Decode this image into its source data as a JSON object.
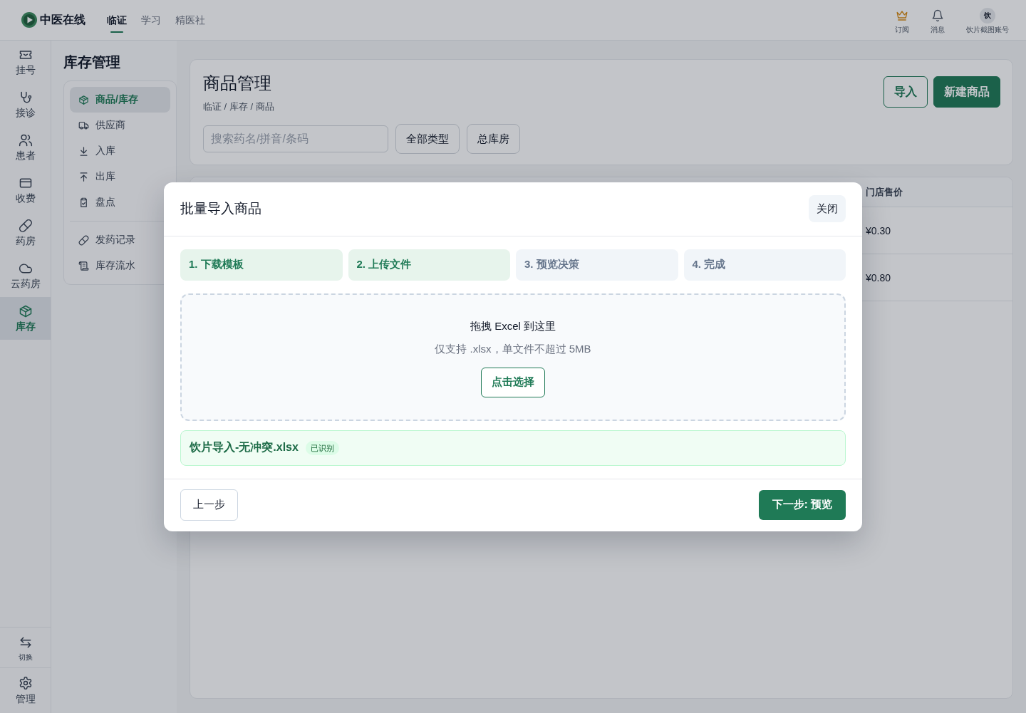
{
  "top_bar": {
    "brand": "中医在线",
    "nav": [
      {
        "label": "临证",
        "selected": true
      },
      {
        "label": "学习",
        "selected": false
      },
      {
        "label": "精医社",
        "selected": false
      }
    ],
    "actions": [
      {
        "label": "订阅"
      },
      {
        "label": "消息"
      }
    ],
    "account": {
      "avatar_text": "饮",
      "name": "饮片截图账号"
    }
  },
  "rail": {
    "items": [
      {
        "label": "挂号",
        "selected": false
      },
      {
        "label": "接诊",
        "selected": false
      },
      {
        "label": "患者",
        "selected": false
      },
      {
        "label": "收费",
        "selected": false
      },
      {
        "label": "药房",
        "selected": false
      },
      {
        "label": "云药房",
        "selected": false
      },
      {
        "label": "库存",
        "selected": true
      }
    ],
    "switch_label": "切换",
    "manage_label": "管理"
  },
  "sidebar": {
    "title": "库存管理",
    "groups": [
      {
        "items": [
          {
            "label": "商品/库存",
            "selected": true
          },
          {
            "label": "供应商",
            "selected": false
          },
          {
            "label": "入库",
            "selected": false
          },
          {
            "label": "出库",
            "selected": false
          },
          {
            "label": "盘点",
            "selected": false
          }
        ]
      },
      {
        "items": [
          {
            "label": "发药记录",
            "selected": false
          },
          {
            "label": "库存流水",
            "selected": false
          }
        ]
      }
    ]
  },
  "page_header": {
    "title": "商品管理",
    "breadcrumb": "临证 / 库存 / 商品",
    "buttons": [
      {
        "label": "导入",
        "kind": "outline"
      },
      {
        "label": "新建商品",
        "kind": "primary"
      }
    ],
    "search": {
      "placeholder": "搜索药名/拼音/条码"
    },
    "filters": [
      {
        "label": "全部类型"
      },
      {
        "label": "总库房"
      }
    ]
  },
  "table": {
    "columns": [
      {
        "label": "门店售价"
      }
    ],
    "rows": [
      {
        "cells": [
          "¥0.30"
        ]
      },
      {
        "cells": [
          "¥0.80"
        ]
      }
    ]
  },
  "modal": {
    "title": "批量导入商品",
    "close_label": "关闭",
    "steps": [
      {
        "label": "1. 下载模板",
        "reached": true
      },
      {
        "label": "2. 上传文件",
        "reached": true
      },
      {
        "label": "3. 预览决策",
        "reached": false
      },
      {
        "label": "4. 完成",
        "reached": false
      }
    ],
    "dropzone": {
      "title": "拖拽 Excel 到这里",
      "hint": "仅支持 .xlsx，单文件不超过 5MB",
      "button": "点击选择"
    },
    "file": {
      "name": "饮片导入-无冲突.xlsx",
      "status": "已识别"
    },
    "footer_buttons": [
      {
        "label": "上一步",
        "kind": "secondary"
      },
      {
        "label": "下一步: 预览",
        "kind": "primary"
      }
    ]
  }
}
